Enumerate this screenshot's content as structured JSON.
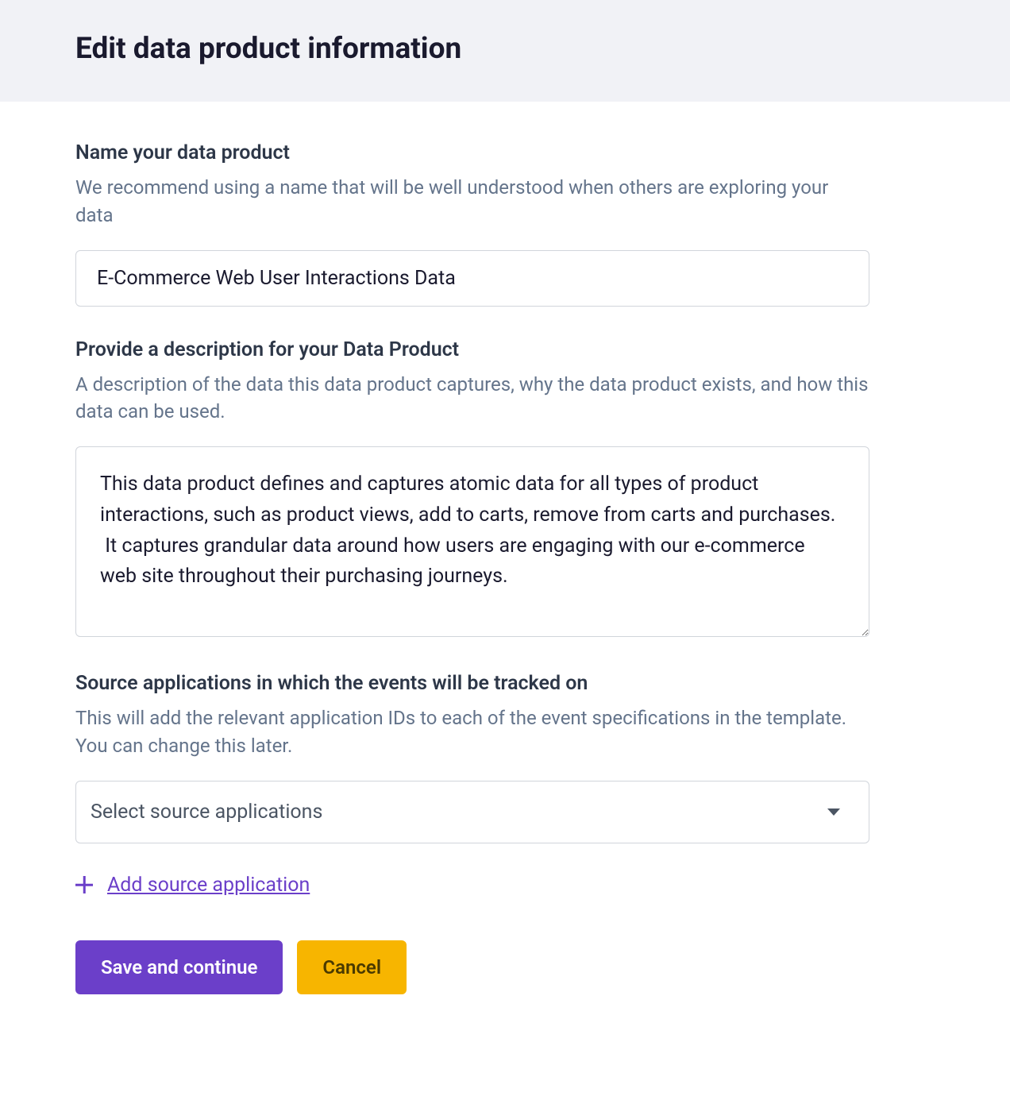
{
  "header": {
    "title": "Edit data product information"
  },
  "name_section": {
    "label": "Name your data product",
    "help": "We recommend using a name that will be well understood when others are exploring your data",
    "value": "E-Commerce Web User Interactions Data"
  },
  "description_section": {
    "label": "Provide a description for your Data Product",
    "help": "A description of the data this data product captures, why the data product exists, and how this data can be used.",
    "value": "This data product defines and captures atomic data for all types of product interactions, such as product views, add to carts, remove from carts and purchases.\n It captures grandular data around how users are engaging with our e-commerce web site throughout their purchasing journeys."
  },
  "source_section": {
    "label": "Source applications in which the events will be tracked on",
    "help": "This will add the relevant application IDs to each of the event specifications in the template. You can change this later.",
    "placeholder": "Select source applications",
    "add_link_label": "Add source application"
  },
  "actions": {
    "save_label": "Save and continue",
    "cancel_label": "Cancel"
  }
}
